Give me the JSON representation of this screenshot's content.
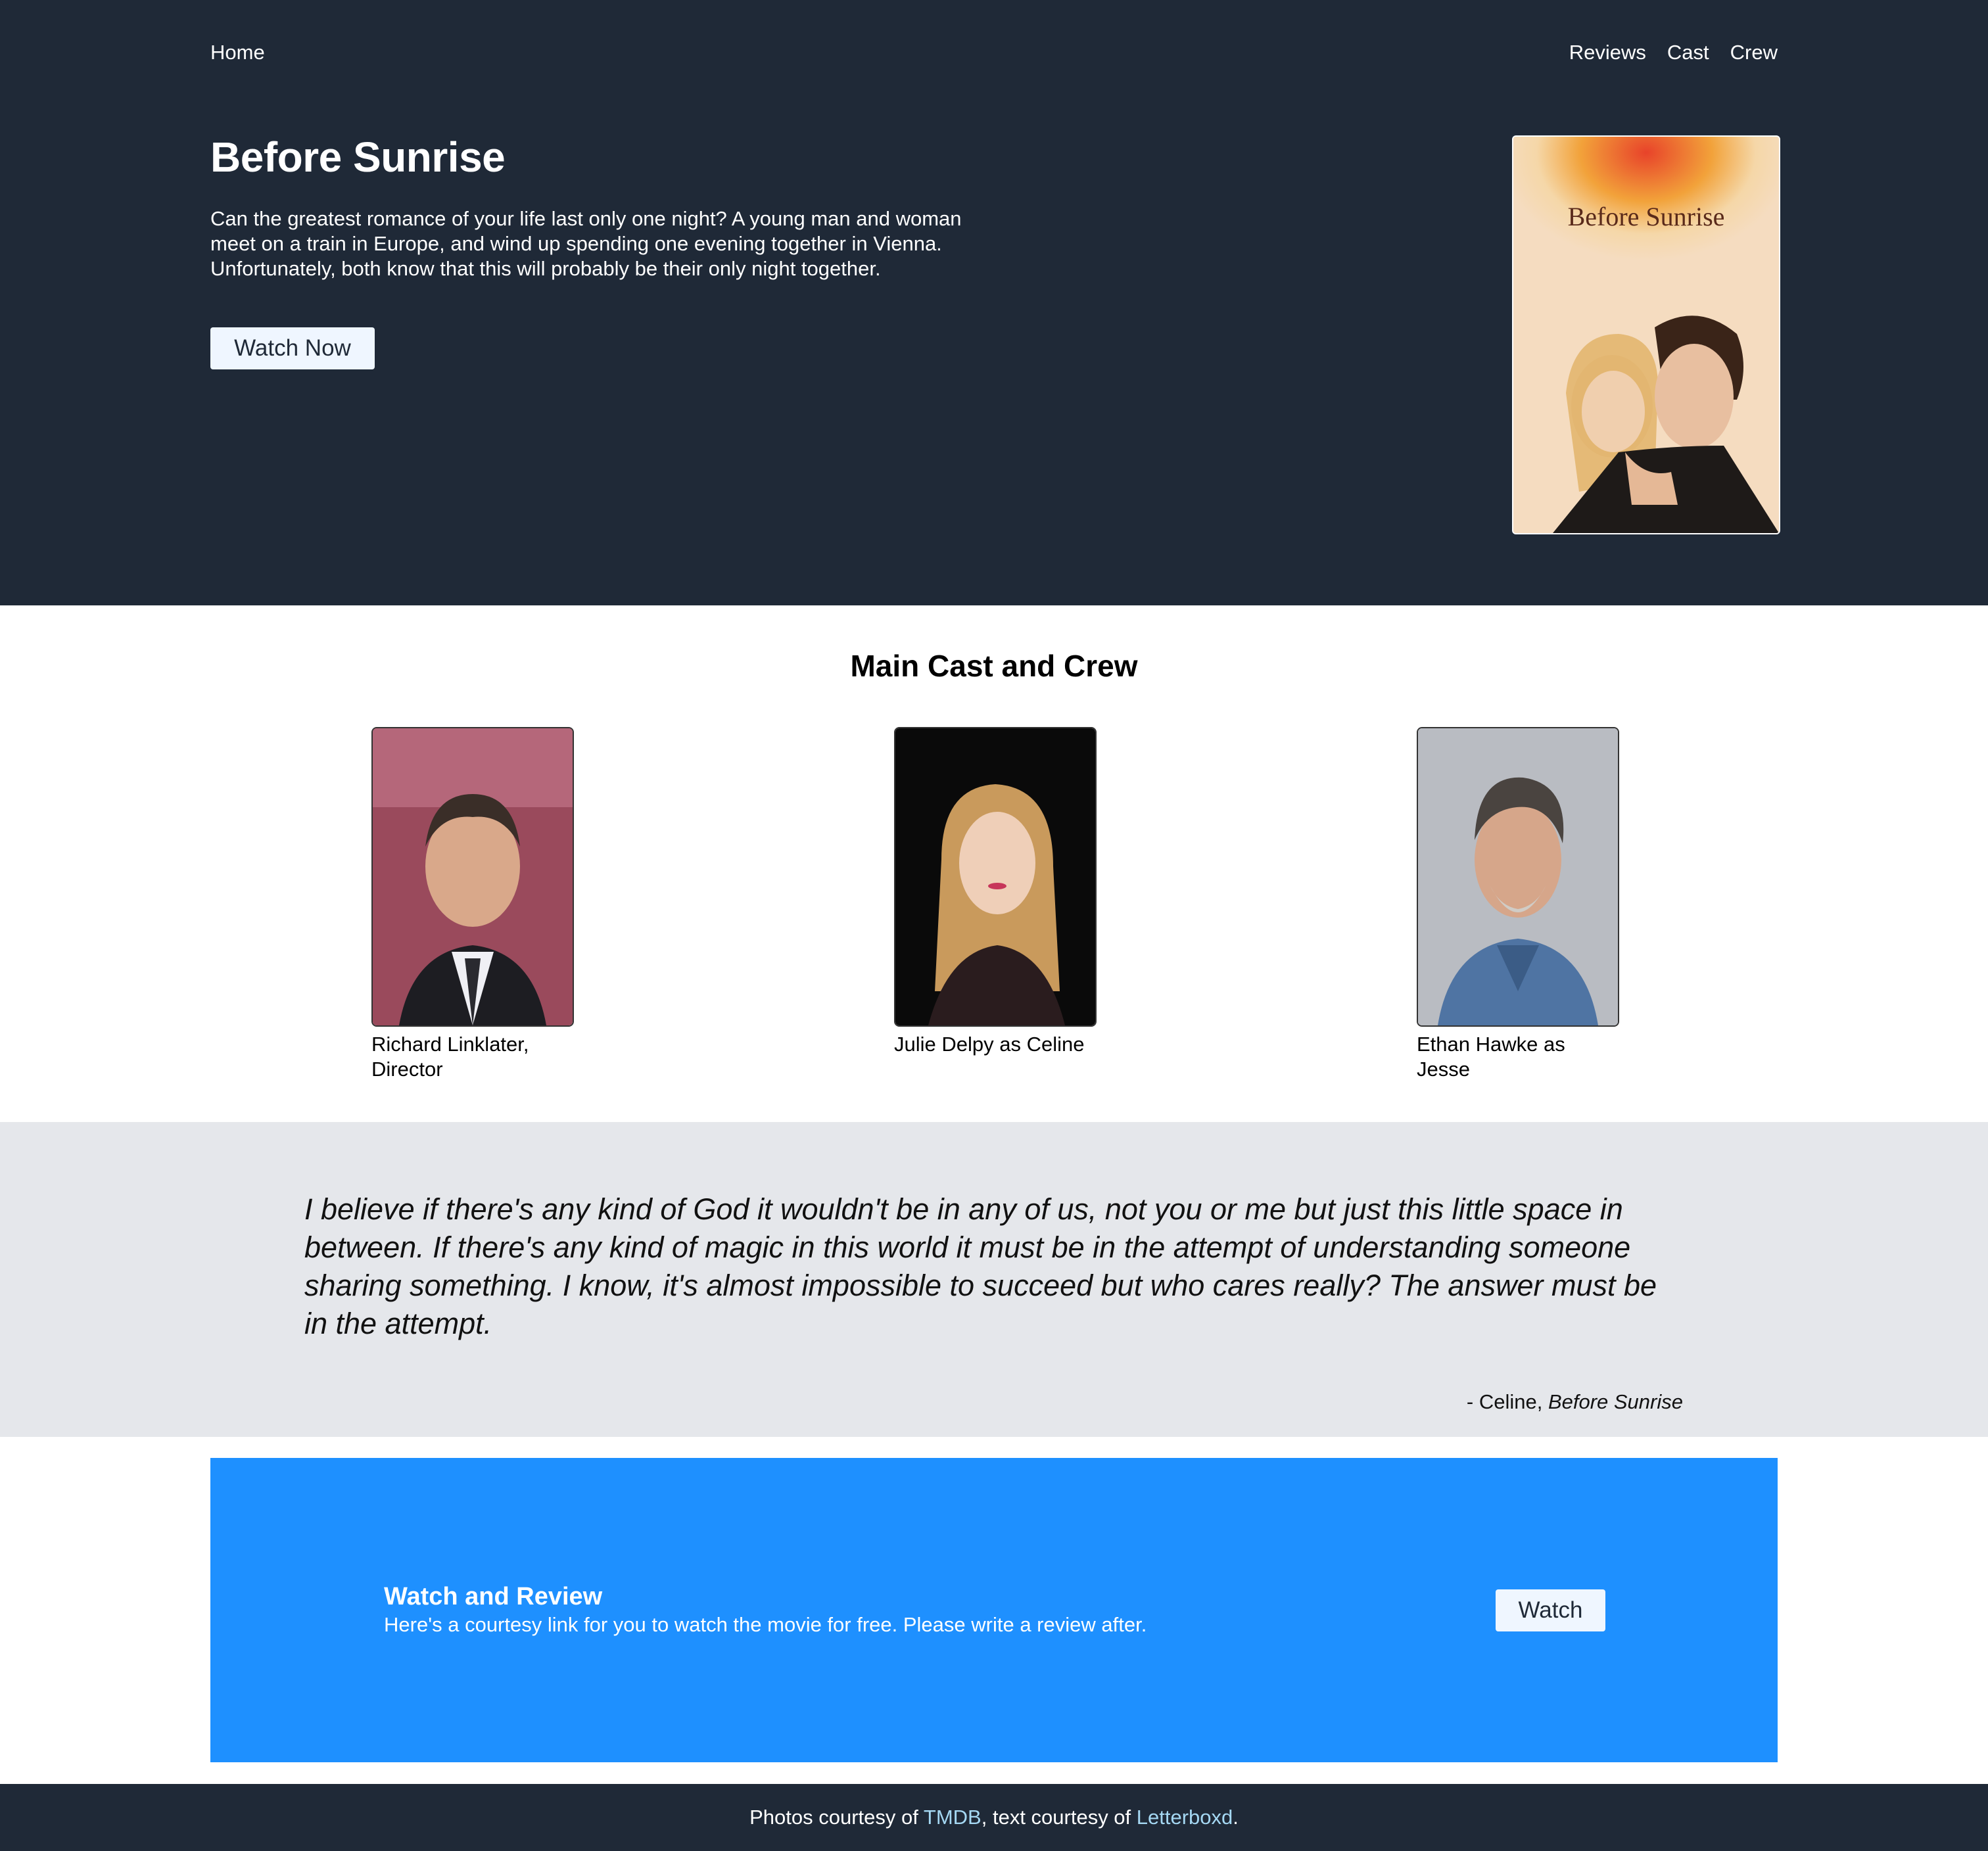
{
  "nav": {
    "home": "Home",
    "links": [
      "Reviews",
      "Cast",
      "Crew"
    ]
  },
  "hero": {
    "title": "Before Sunrise",
    "description": "Can the greatest romance of your life last only one night? A young man and woman meet on a train in Europe, and wind up spending one evening together in Vienna. Unfortunately, both know that this will probably be their only night together.",
    "button": "Watch Now",
    "poster_title": "Before Sunrise"
  },
  "cast": {
    "title": "Main Cast and Crew",
    "members": [
      {
        "caption": "Richard Linklater, Director"
      },
      {
        "caption": "Julie Delpy as Celine"
      },
      {
        "caption": "Ethan Hawke as Jesse"
      }
    ]
  },
  "quote": {
    "text": "I believe if there's any kind of God it wouldn't be in any of us, not you or me but just this little space in between. If there's any kind of magic in this world it must be in the attempt of understanding someone sharing something. I know, it's almost impossible to succeed but who cares really? The answer must be in the attempt.",
    "attribution_prefix": "- Celine, ",
    "attribution_work": "Before Sunrise"
  },
  "cta": {
    "title": "Watch and Review",
    "text": "Here's a courtesy link for you to watch the movie for free. Please write a review after.",
    "button": "Watch"
  },
  "footer": {
    "prefix": "Photos courtesy of ",
    "link1": "TMDB",
    "middle": ", text courtesy of ",
    "link2": "Letterboxd",
    "suffix": "."
  },
  "colors": {
    "header_bg": "#1f2937",
    "quote_bg": "#e5e7eb",
    "cta_bg": "#1e90ff",
    "footer_link": "#a5d8f3"
  }
}
